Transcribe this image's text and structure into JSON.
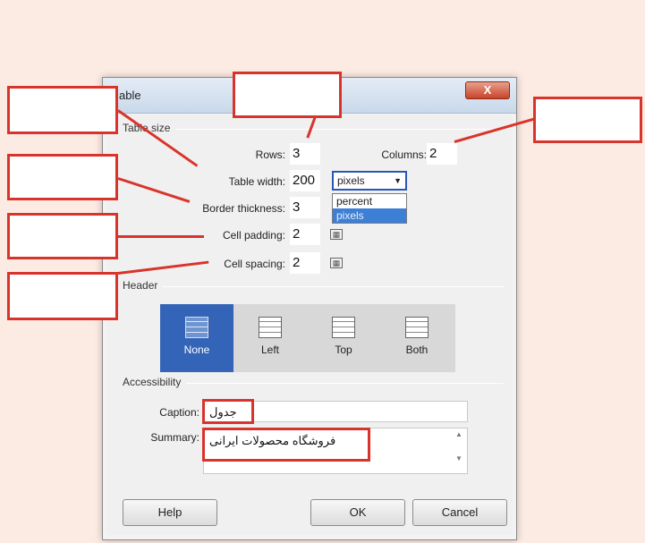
{
  "dialog": {
    "title": "able",
    "close_label": "X",
    "table_size": {
      "group_label": "Table size",
      "rows_label": "Rows:",
      "rows_value": "3",
      "columns_label": "Columns:",
      "columns_value": "2",
      "width_label": "Table width:",
      "width_value": "200",
      "width_unit": "pixels",
      "unit_options": [
        "percent",
        "pixels"
      ],
      "border_label": "Border thickness:",
      "border_value": "3",
      "padding_label": "Cell padding:",
      "padding_value": "2",
      "spacing_label": "Cell spacing:",
      "spacing_value": "2"
    },
    "header": {
      "group_label": "Header",
      "options": [
        "None",
        "Left",
        "Top",
        "Both"
      ],
      "selected": "None"
    },
    "accessibility": {
      "group_label": "Accessibility",
      "caption_label": "Caption:",
      "caption_value": "جدول",
      "summary_label": "Summary:",
      "summary_value": "فروشگاه محصولات ایرانی"
    },
    "buttons": {
      "help": "Help",
      "ok": "OK",
      "cancel": "Cancel"
    }
  },
  "colors": {
    "annotation": "#d9342c",
    "selected_header": "#3364b8",
    "background": "#fcebe3"
  }
}
